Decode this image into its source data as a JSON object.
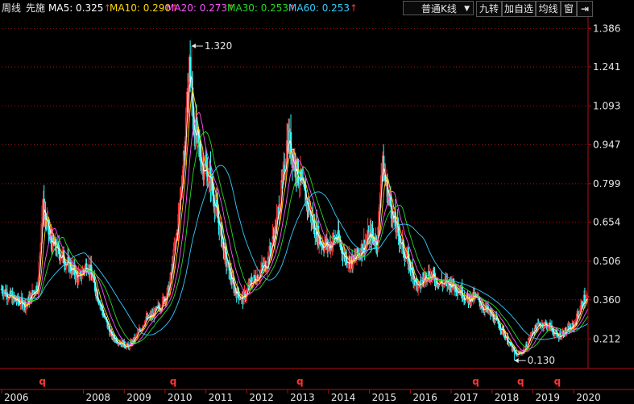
{
  "header": {
    "period_label": "周线",
    "stock_name": "先施",
    "ma": [
      {
        "label": "MA5: 0.325",
        "arrow": "↑",
        "color": "#ffffff"
      },
      {
        "label": "MA10: 0.290",
        "arrow": "↑",
        "color": "#ffd700"
      },
      {
        "label": "MA20: 0.273",
        "arrow": "↑",
        "color": "#ff55ff"
      },
      {
        "label": "MA30: 0.253",
        "arrow": "↑",
        "color": "#22dd22"
      },
      {
        "label": "MA60: 0.253",
        "arrow": "↑",
        "color": "#33ccff"
      }
    ]
  },
  "toolbar": {
    "kline_type": "普通K线",
    "dropdown_arrow": "▼",
    "btn_jiuzhuan": "九转",
    "btn_add_watch": "加自选",
    "btn_ma": "均线",
    "btn_window": "窗",
    "btn_exit": "⇥"
  },
  "colors": {
    "up": "#ff3333",
    "down": "#33ffff",
    "axis": "#b01010",
    "label": "#e8e8e8",
    "marker": "#ff3333"
  },
  "chart_data": {
    "type": "candlestick",
    "title": "先施 周线",
    "y_ticks": [
      "1.386",
      "1.241",
      "1.093",
      "0.947",
      "0.799",
      "0.654",
      "0.506",
      "0.360",
      "0.212"
    ],
    "ylim": [
      0.1,
      1.43
    ],
    "x_ticks": [
      "2006",
      "2008",
      "2009",
      "2010",
      "2011",
      "2012",
      "2013",
      "2014",
      "2015",
      "2016",
      "2017",
      "2018",
      "2019",
      "2020"
    ],
    "xlim": [
      2006.0,
      2020.35
    ],
    "annotations": [
      {
        "text": "1.320",
        "x": 2010.65,
        "y": 1.32
      },
      {
        "text": "0.130",
        "x": 2018.55,
        "y": 0.13
      }
    ],
    "q_markers": [
      {
        "label": "q",
        "x": 2007.0
      },
      {
        "label": "q",
        "x": 2010.2
      },
      {
        "label": "q",
        "x": 2013.3
      },
      {
        "label": "q",
        "x": 2017.6
      },
      {
        "label": "q",
        "x": 2018.7
      },
      {
        "label": "q",
        "x": 2019.6
      }
    ],
    "price_path": [
      [
        2006.0,
        0.4
      ],
      [
        2006.3,
        0.36
      ],
      [
        2006.6,
        0.34
      ],
      [
        2006.9,
        0.42
      ],
      [
        2007.0,
        0.72
      ],
      [
        2007.2,
        0.58
      ],
      [
        2007.5,
        0.52
      ],
      [
        2007.7,
        0.48
      ],
      [
        2007.9,
        0.44
      ],
      [
        2008.1,
        0.5
      ],
      [
        2008.3,
        0.4
      ],
      [
        2008.5,
        0.3
      ],
      [
        2008.7,
        0.22
      ],
      [
        2008.9,
        0.2
      ],
      [
        2009.1,
        0.18
      ],
      [
        2009.3,
        0.22
      ],
      [
        2009.5,
        0.28
      ],
      [
        2009.7,
        0.3
      ],
      [
        2009.9,
        0.34
      ],
      [
        2010.1,
        0.4
      ],
      [
        2010.3,
        0.62
      ],
      [
        2010.5,
        0.98
      ],
      [
        2010.6,
        1.25
      ],
      [
        2010.7,
        1.02
      ],
      [
        2010.9,
        0.88
      ],
      [
        2011.1,
        0.82
      ],
      [
        2011.3,
        0.66
      ],
      [
        2011.5,
        0.5
      ],
      [
        2011.7,
        0.4
      ],
      [
        2011.9,
        0.36
      ],
      [
        2012.1,
        0.42
      ],
      [
        2012.3,
        0.46
      ],
      [
        2012.5,
        0.5
      ],
      [
        2012.7,
        0.62
      ],
      [
        2012.9,
        0.82
      ],
      [
        2013.0,
        0.98
      ],
      [
        2013.2,
        0.86
      ],
      [
        2013.4,
        0.76
      ],
      [
        2013.6,
        0.66
      ],
      [
        2013.8,
        0.58
      ],
      [
        2014.0,
        0.56
      ],
      [
        2014.2,
        0.6
      ],
      [
        2014.4,
        0.52
      ],
      [
        2014.6,
        0.5
      ],
      [
        2014.8,
        0.55
      ],
      [
        2015.0,
        0.6
      ],
      [
        2015.2,
        0.58
      ],
      [
        2015.3,
        0.88
      ],
      [
        2015.4,
        0.8
      ],
      [
        2015.6,
        0.66
      ],
      [
        2015.8,
        0.56
      ],
      [
        2016.0,
        0.48
      ],
      [
        2016.2,
        0.4
      ],
      [
        2016.4,
        0.46
      ],
      [
        2016.6,
        0.44
      ],
      [
        2016.8,
        0.42
      ],
      [
        2017.0,
        0.42
      ],
      [
        2017.2,
        0.4
      ],
      [
        2017.4,
        0.36
      ],
      [
        2017.6,
        0.37
      ],
      [
        2017.8,
        0.33
      ],
      [
        2018.0,
        0.3
      ],
      [
        2018.2,
        0.26
      ],
      [
        2018.4,
        0.2
      ],
      [
        2018.6,
        0.15
      ],
      [
        2018.8,
        0.17
      ],
      [
        2019.0,
        0.24
      ],
      [
        2019.2,
        0.27
      ],
      [
        2019.4,
        0.26
      ],
      [
        2019.6,
        0.22
      ],
      [
        2019.8,
        0.24
      ],
      [
        2020.0,
        0.26
      ],
      [
        2020.15,
        0.32
      ],
      [
        2020.25,
        0.36
      ]
    ],
    "ma_lines": [
      {
        "name": "MA5",
        "color": "#ffffff",
        "lag": 0.08,
        "points": []
      },
      {
        "name": "MA10",
        "color": "#ffd700",
        "lag": 0.18,
        "points": []
      },
      {
        "name": "MA20",
        "color": "#ff55ff",
        "lag": 0.35,
        "points": []
      },
      {
        "name": "MA30",
        "color": "#22dd22",
        "lag": 0.55,
        "points": []
      },
      {
        "name": "MA60",
        "color": "#33ccff",
        "lag": 1.1,
        "points": []
      }
    ]
  }
}
